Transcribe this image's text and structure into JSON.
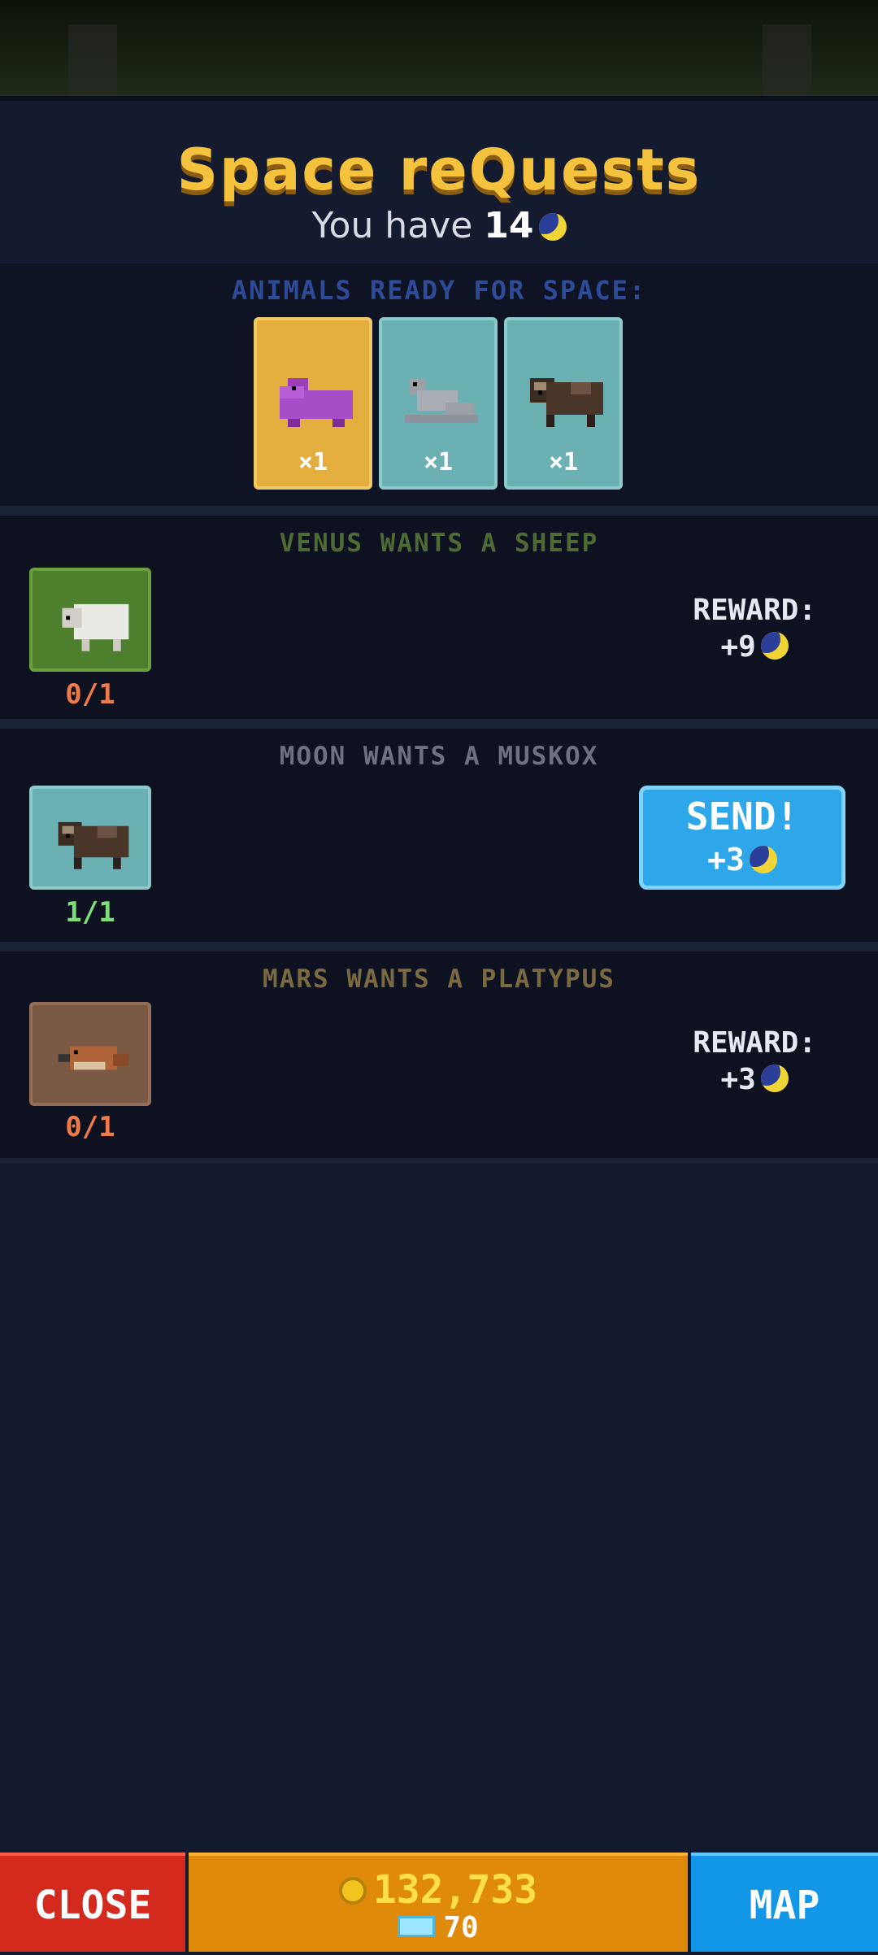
{
  "header": {
    "title": "Space reQuests",
    "subtitle_prefix": "You have",
    "moon_count": "14"
  },
  "ready": {
    "label": "ANIMALS READY FOR SPACE:",
    "cards": [
      {
        "animal": "hippo-icon",
        "count": "×1",
        "bg": "#e3ae3d"
      },
      {
        "animal": "seal-icon",
        "count": "×1",
        "bg": "#6bb0b3"
      },
      {
        "animal": "muskox-icon",
        "count": "×1",
        "bg": "#6bb0b3"
      }
    ]
  },
  "quests": [
    {
      "title": "VENUS WANTS A SHEEP",
      "progress": "0/1",
      "reward_label": "REWARD:",
      "reward_value": "+9",
      "color": "#4e6a35"
    },
    {
      "title": "MOON WANTS A MUSKOX",
      "progress": "1/1",
      "send_label": "SEND!",
      "send_value": "+3",
      "color": "#6e7280"
    },
    {
      "title": "MARS WANTS A PLATYPUS",
      "progress": "0/1",
      "reward_label": "REWARD:",
      "reward_value": "+3",
      "color": "#7a6a42"
    }
  ],
  "bottom": {
    "close_label": "CLOSE",
    "coins": "132,733",
    "gems": "70",
    "map_label": "MAP"
  }
}
